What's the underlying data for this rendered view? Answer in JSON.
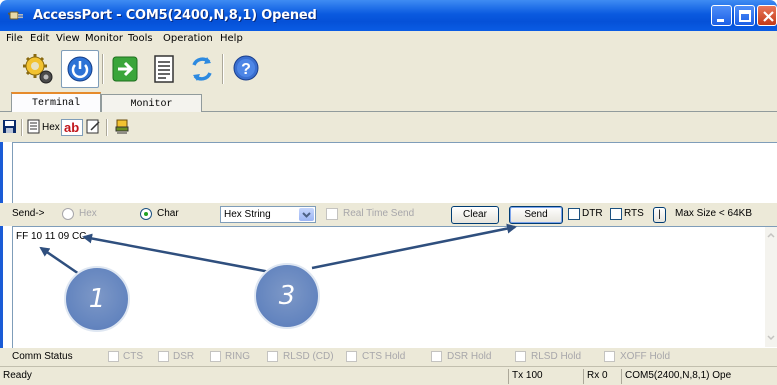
{
  "window": {
    "title": "AccessPort - COM5(2400,N,8,1) Opened",
    "accent": "#0a5ae0"
  },
  "menu": [
    "File",
    "Edit",
    "View",
    "Monitor",
    "Tools",
    "Operation",
    "Help"
  ],
  "toolbar": {
    "buttons": [
      "settings-gear-icon",
      "power-icon",
      "go-arrow-icon",
      "notepad-icon",
      "refresh-icon",
      "help-icon"
    ]
  },
  "tabs": [
    {
      "label": "Terminal",
      "active": true
    },
    {
      "label": "Monitor",
      "active": false
    }
  ],
  "subtoolbar": {
    "hex_label": "Hex",
    "ab_label": "ab"
  },
  "send_bar": {
    "send_label": "Send->",
    "hex_radio": "Hex",
    "char_radio": "Char",
    "format_value": "Hex String",
    "realtime_label": "Real Time Send",
    "clear_button": "Clear",
    "send_button": "Send",
    "dtr_label": "DTR",
    "rts_label": "RTS",
    "pipe_button": "|",
    "max_size": "Max Size < 64KB"
  },
  "send_area": {
    "content": "FF 10 11 09 CC"
  },
  "comm_status": {
    "label": "Comm Status",
    "signals": [
      "CTS",
      "DSR",
      "RING",
      "RLSD (CD)",
      "CTS Hold",
      "DSR Hold",
      "RLSD Hold",
      "XOFF Hold"
    ]
  },
  "status_bar": {
    "state": "Ready",
    "tx": "Tx 100",
    "rx": "Rx 0",
    "port": "COM5(2400,N,8,1) Ope"
  },
  "callouts": [
    "1",
    "3"
  ]
}
